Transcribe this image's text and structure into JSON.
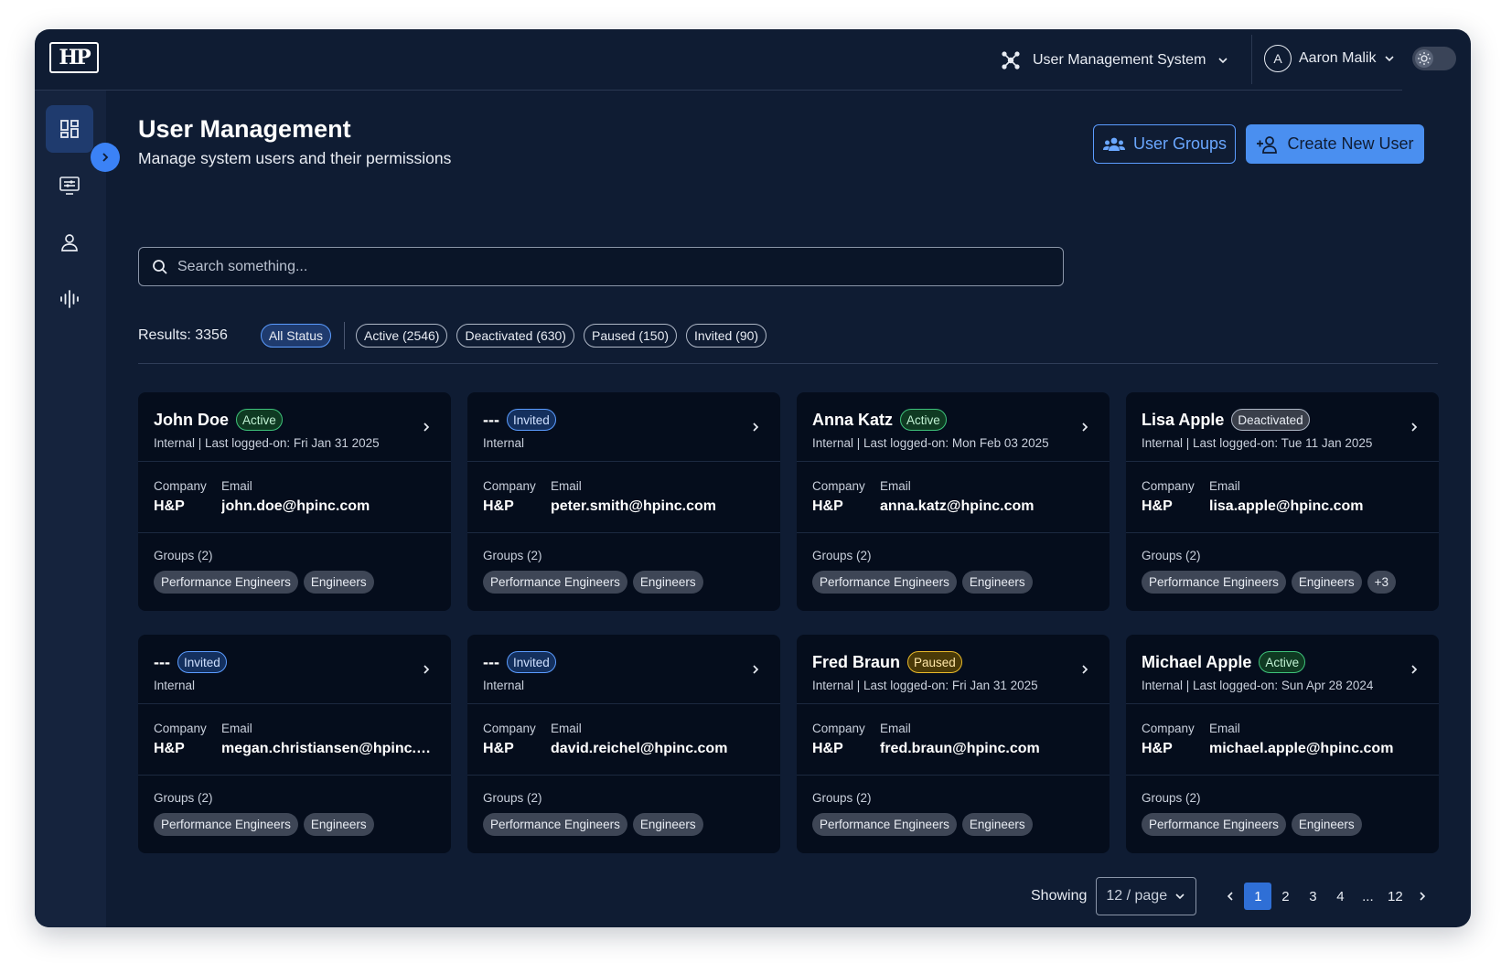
{
  "header": {
    "logo_text": "HP",
    "system_name": "User Management System",
    "user_initial": "A",
    "user_name": "Aaron Malik"
  },
  "sidebar": {
    "items": [
      {
        "icon": "dashboard-icon",
        "active": true
      },
      {
        "icon": "monitor-settings-icon",
        "active": false
      },
      {
        "icon": "user-icon",
        "active": false
      },
      {
        "icon": "audio-wave-icon",
        "active": false
      }
    ]
  },
  "page": {
    "title": "User Management",
    "subtitle": "Manage system users and their permissions",
    "user_groups_label": "User Groups",
    "create_user_label": "Create New User"
  },
  "search": {
    "placeholder": "Search something..."
  },
  "filters": {
    "results_label": "Results:",
    "results_count": "3356",
    "chips": [
      {
        "label": "All Status",
        "selected": true
      },
      {
        "label": "Active (2546)",
        "selected": false
      },
      {
        "label": "Deactivated (630)",
        "selected": false
      },
      {
        "label": "Paused (150)",
        "selected": false
      },
      {
        "label": "Invited (90)",
        "selected": false
      }
    ]
  },
  "labels": {
    "company": "Company",
    "email": "Email",
    "groups": "Groups (2)"
  },
  "users": [
    {
      "name": "John Doe",
      "status": "Active",
      "status_kind": "active",
      "meta": "Internal | Last logged-on: Fri Jan 31 2025",
      "company": "H&P",
      "email": "john.doe@hpinc.com",
      "groups_label": "Groups (2)",
      "tags": [
        "Performance Engineers",
        "Engineers"
      ]
    },
    {
      "name": "---",
      "status": "Invited",
      "status_kind": "invited",
      "meta": "Internal",
      "company": "H&P",
      "email": "peter.smith@hpinc.com",
      "groups_label": "Groups (2)",
      "tags": [
        "Performance Engineers",
        "Engineers"
      ]
    },
    {
      "name": "Anna Katz",
      "status": "Active",
      "status_kind": "active",
      "meta": "Internal | Last logged-on: Mon Feb 03 2025",
      "company": "H&P",
      "email": "anna.katz@hpinc.com",
      "groups_label": "Groups (2)",
      "tags": [
        "Performance Engineers",
        "Engineers"
      ]
    },
    {
      "name": "Lisa Apple",
      "status": "Deactivated",
      "status_kind": "deactivated",
      "meta": "Internal | Last logged-on: Tue 11 Jan 2025",
      "company": "H&P",
      "email": "lisa.apple@hpinc.com",
      "groups_label": "Groups (2)",
      "tags": [
        "Performance Engineers",
        "Engineers",
        "+3"
      ]
    },
    {
      "name": "---",
      "status": "Invited",
      "status_kind": "invited",
      "meta": "Internal",
      "company": "H&P",
      "email": "megan.christiansen@hpinc.com",
      "groups_label": "Groups (2)",
      "tags": [
        "Performance Engineers",
        "Engineers"
      ]
    },
    {
      "name": "---",
      "status": "Invited",
      "status_kind": "invited",
      "meta": "Internal",
      "company": "H&P",
      "email": "david.reichel@hpinc.com",
      "groups_label": "Groups (2)",
      "tags": [
        "Performance Engineers",
        "Engineers"
      ]
    },
    {
      "name": "Fred Braun",
      "status": "Paused",
      "status_kind": "paused",
      "meta": "Internal | Last logged-on: Fri Jan 31 2025",
      "company": "H&P",
      "email": "fred.braun@hpinc.com",
      "groups_label": "Groups (2)",
      "tags": [
        "Performance Engineers",
        "Engineers"
      ]
    },
    {
      "name": "Michael Apple",
      "status": "Active",
      "status_kind": "active",
      "meta": "Internal | Last logged-on: Sun Apr 28 2024",
      "company": "H&P",
      "email": "michael.apple@hpinc.com",
      "groups_label": "Groups (2)",
      "tags": [
        "Performance Engineers",
        "Engineers"
      ]
    }
  ],
  "pagination": {
    "showing_label": "Showing",
    "page_size": "12 / page",
    "pages": [
      "1",
      "2",
      "3",
      "4",
      "...",
      "12"
    ],
    "current": "1"
  },
  "colors": {
    "background": "#0f1c33",
    "accent": "#4a8ff0",
    "active": "#3ec27a",
    "invited": "#5b9cff",
    "paused": "#e8b92a"
  }
}
